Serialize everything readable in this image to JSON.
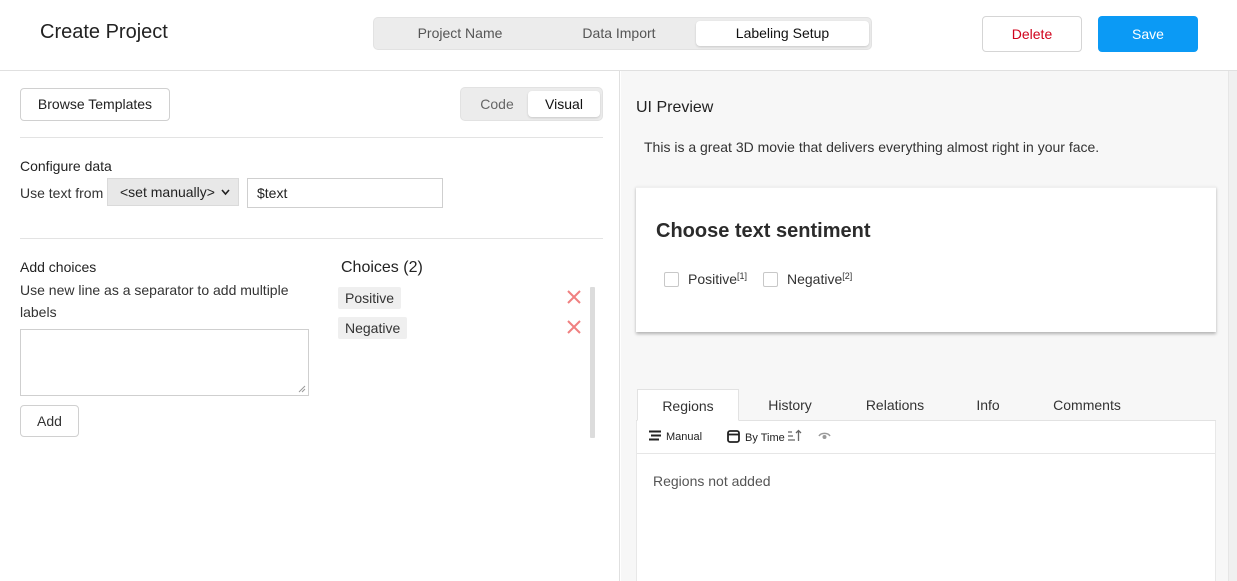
{
  "header": {
    "title": "Create Project",
    "steps": [
      "Project Name",
      "Data Import",
      "Labeling Setup"
    ],
    "active_step": "Labeling Setup",
    "delete_label": "Delete",
    "save_label": "Save"
  },
  "left": {
    "browse_label": "Browse Templates",
    "view_toggle": [
      "Code",
      "Visual"
    ],
    "active_view": "Visual",
    "configure": {
      "heading": "Configure data",
      "use_text_label": "Use text from",
      "select_value": "<set manually>",
      "text_value": "$text"
    },
    "add_choices": {
      "heading": "Add choices",
      "hint": "Use new line as a separator to add multiple labels",
      "add_label": "Add"
    },
    "choices": {
      "heading": "Choices (2)",
      "items": [
        "Positive",
        "Negative"
      ]
    }
  },
  "right": {
    "preview_heading": "UI Preview",
    "sample_text": "This is a great 3D movie that delivers everything almost right in your face.",
    "card": {
      "title": "Choose text sentiment",
      "options": [
        {
          "label": "Positive",
          "hotkey": "[1]"
        },
        {
          "label": "Negative",
          "hotkey": "[2]"
        }
      ]
    },
    "tabs": [
      "Regions",
      "History",
      "Relations",
      "Info",
      "Comments"
    ],
    "active_tab": "Regions",
    "toolbar": {
      "manual": "Manual",
      "by_time": "By Time"
    },
    "empty_text": "Regions not added"
  },
  "colors": {
    "accent": "#0b9af5",
    "danger": "#d0021b",
    "remove": "#f08080"
  }
}
